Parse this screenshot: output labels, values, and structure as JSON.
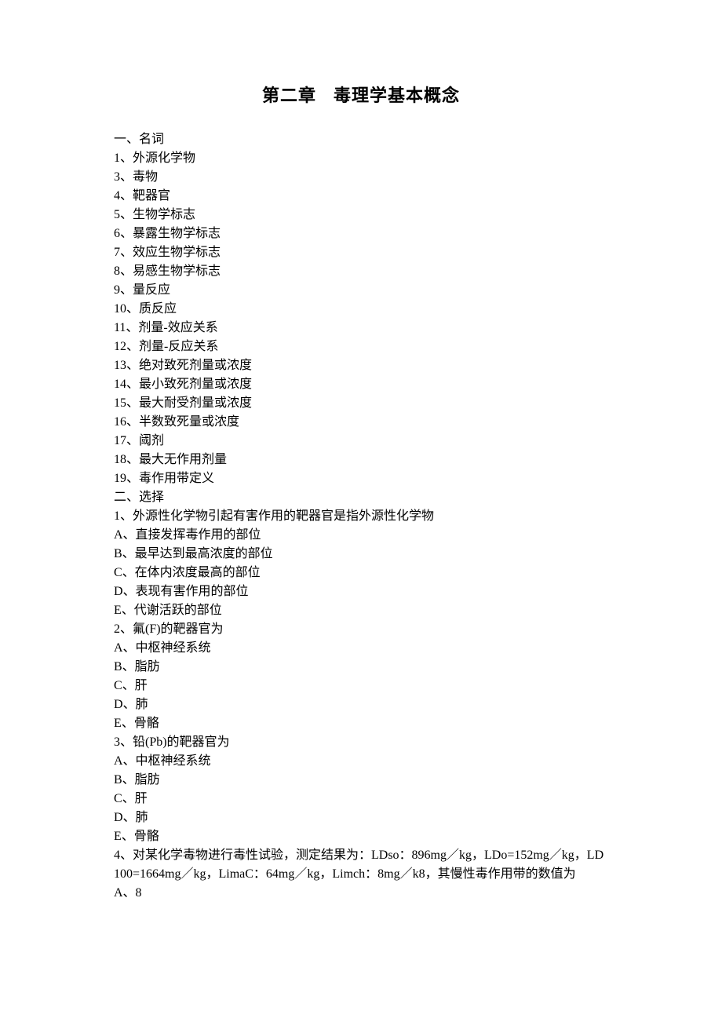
{
  "title_a": "第二章",
  "title_b": "毒理学基本概念",
  "lines": [
    "一、名词",
    "1、外源化学物",
    "3、毒物",
    "4、靶器官",
    "5、生物学标志",
    "6、暴露生物学标志",
    "7、效应生物学标志",
    "8、易感生物学标志",
    "9、量反应",
    "10、质反应",
    "11、剂量-效应关系",
    "12、剂量-反应关系",
    "13、绝对致死剂量或浓度",
    "14、最小致死剂量或浓度",
    "15、最大耐受剂量或浓度",
    "16、半数致死量或浓度",
    "17、阈剂",
    "18、最大无作用剂量",
    "19、毒作用带定义",
    "二、选择",
    "1、外源性化学物引起有害作用的靶器官是指外源性化学物",
    "A、直接发挥毒作用的部位",
    "B、最早达到最高浓度的部位",
    "C、在体内浓度最高的部位",
    "D、表现有害作用的部位",
    "E、代谢活跃的部位",
    "2、氟(F)的靶器官为",
    "A、中枢神经系统",
    "B、脂肪",
    "C、肝",
    "D、肺",
    "E、骨骼",
    "3、铅(Pb)的靶器官为",
    "A、中枢神经系统",
    "B、脂肪",
    "C、肝",
    "D、肺",
    "E、骨骼",
    "4、对某化学毒物进行毒性试验，测定结果为：LDso：896mg／kg，LDo=152mg／kg，LD100=1664mg／kg，LimaC：64mg／kg，Limch：8mg／k8，其慢性毒作用带的数值为",
    "A、8"
  ]
}
